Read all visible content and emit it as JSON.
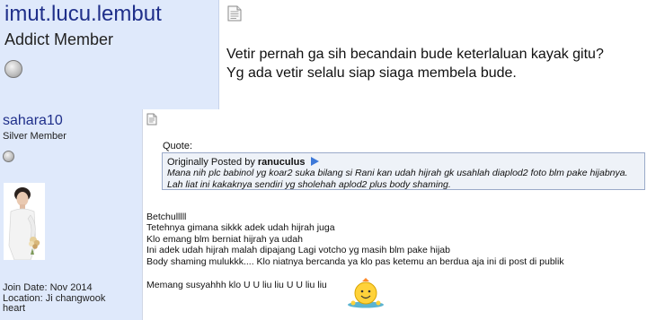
{
  "top_post": {
    "username": "imut.lucu.lembut",
    "rank": "Addict Member",
    "message_lines": [
      "Vetir pernah ga sih becandain bude keterlaluan kayak gitu?",
      "Yg ada vetir selalu siap siaga membela bude."
    ]
  },
  "bottom_post": {
    "username": "sahara10",
    "rank": "Silver Member",
    "join_lines": [
      "Join Date: Nov 2014",
      "Location: Ji changwook",
      "heart"
    ],
    "quote": {
      "label": "Quote:",
      "by_prefix": "Originally Posted by",
      "author": "ranuculus",
      "lines": [
        "Mana nih plc babinol yg koar2 suka bilang si Rani kan udah hijrah gk usahlah diaplod2 foto blm pake hijabnya.",
        "Lah liat ini kakaknya sendiri yg sholehah aplod2 plus body shaming."
      ]
    },
    "reply_lines": [
      "Betchulllll",
      "Tetehnya gimana sikkk adek udah hijrah juga",
      "Klo emang blm berniat hijrah ya udah",
      "Ini adek udah hijrah malah dipajang Lagi votcho yg masih blm pake hijab",
      "Body shaming mulukkk.... Klo niatnya bercanda ya klo pas ketemu an berdua aja ini di post di publik"
    ],
    "reply_last": "Memang susyahhh klo U U liu liu U U liu liu"
  },
  "icons": {
    "post_icon": "document-icon",
    "status": "offline-status-icon",
    "quote_link": "view-post-arrow-icon",
    "smiley": "smiley-emoticon"
  }
}
